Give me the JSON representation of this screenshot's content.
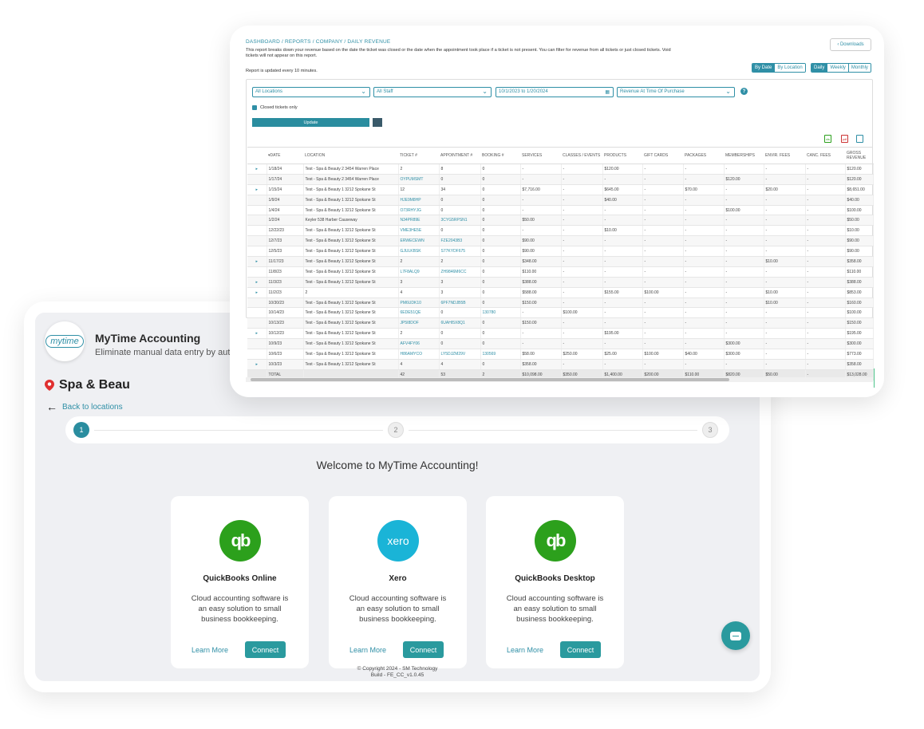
{
  "app": {
    "logo_text": "mytime",
    "title": "MyTime Accounting",
    "subtitle": "Eliminate manual data entry by automating yo",
    "location_name": "Spa & Beau",
    "back_label": "Back to locations",
    "steps": [
      "1",
      "2",
      "3"
    ],
    "welcome": "Welcome to MyTime Accounting!",
    "providers": [
      {
        "name": "QuickBooks Online",
        "logo": "qb",
        "description": "Cloud accounting software is an easy solution to small business bookkeeping.",
        "learn_more": "Learn More",
        "connect": "Connect"
      },
      {
        "name": "Xero",
        "logo": "xero",
        "description": "Cloud accounting software is an easy solution to small business bookkeeping.",
        "learn_more": "Learn More",
        "connect": "Connect"
      },
      {
        "name": "QuickBooks Desktop",
        "logo": "qb",
        "description": "Cloud accounting software is an easy solution to small business bookkeeping.",
        "learn_more": "Learn More",
        "connect": "Connect"
      }
    ],
    "copyright_line1": "© Copyright 2024 - SM Technology",
    "copyright_line2": "Build - FE_CC_v1.0.45",
    "accent_color": "#2a9a9e"
  },
  "report": {
    "breadcrumb": "DASHBOARD / REPORTS / COMPANY / DAILY REVENUE",
    "description": "This report breaks down your revenue based on the date the ticket was closed or the date when the appointment took place if a ticket is not present. You can filter for revenue from all tickets or just closed tickets. Void tickets will not appear on this report.",
    "updated_note": "Report is updated every 10 minutes.",
    "downloads_label": "‹ Downloads",
    "by_date": "By Date",
    "by_location": "By Location",
    "daily": "Daily",
    "weekly": "Weekly",
    "monthly": "Monthly",
    "location_filter": "All Locations",
    "staff_filter": "All Staff",
    "date_range": "10/1/2023 to 1/20/2024",
    "revenue_filter": "Revenue At Time Of Purchase",
    "closed_only_label": "Closed tickets only",
    "update_label": "Update",
    "columns": [
      "",
      "▾DATE",
      "LOCATION",
      "TICKET #",
      "APPOINTMENT #",
      "BOOKING #",
      "SERVICES",
      "CLASSES / EVENTS",
      "PRODUCTS",
      "GIFT CARDS",
      "PACKAGES",
      "MEMBERSHIPS",
      "ENVIR. FEES",
      "CANC. FEES",
      "GROSS REVENUE"
    ],
    "rows": [
      [
        "▸",
        "1/18/24",
        "Test - Spa & Beauty 2 3454 Warren Place",
        "2",
        "8",
        "0",
        "-",
        "-",
        "$120.00",
        "-",
        "-",
        "-",
        "-",
        "-",
        "$120.00"
      ],
      [
        "",
        "1/17/24",
        "Test - Spa & Beauty 2 3454 Warren Place",
        "OYPUMSMT",
        "0",
        "0",
        "-",
        "-",
        "-",
        "-",
        "-",
        "$120.00",
        "-",
        "-",
        "$120.00"
      ],
      [
        "▸",
        "1/15/24",
        "Test - Spa & Beauty 1 3212 Spokane St",
        "12",
        "34",
        "0",
        "$7,716.00",
        "-",
        "$645.00",
        "-",
        "$70.00",
        "-",
        "$20.00",
        "-",
        "$8,651.00"
      ],
      [
        "",
        "1/9/24",
        "Test - Spa & Beauty 1 3212 Spokane St",
        "HJE9M8HP",
        "0",
        "0",
        "-",
        "-",
        "$40.00",
        "-",
        "-",
        "-",
        "-",
        "-",
        "$40.00"
      ],
      [
        "",
        "1/4/24",
        "Test - Spa & Beauty 1 3212 Spokane St",
        "O73RHYJG",
        "0",
        "0",
        "-",
        "-",
        "-",
        "-",
        "-",
        "$100.00",
        "-",
        "-",
        "$100.00"
      ],
      [
        "",
        "1/2/24",
        "Keyler 538 Harber Causeway",
        "N34PR89E",
        "3CYG5RPSN1",
        "0",
        "$50.00",
        "-",
        "-",
        "-",
        "-",
        "-",
        "-",
        "-",
        "$50.00"
      ],
      [
        "",
        "12/22/23",
        "Test - Spa & Beauty 1 3212 Spokane St",
        "VME3HE5E",
        "0",
        "0",
        "-",
        "-",
        "$10.00",
        "-",
        "-",
        "-",
        "-",
        "-",
        "$10.00"
      ],
      [
        "",
        "12/7/23",
        "Test - Spa & Beauty 1 3212 Spokane St",
        "ERWECEWN",
        "FZE2043B3",
        "0",
        "$90.00",
        "-",
        "-",
        "-",
        "-",
        "-",
        "-",
        "-",
        "$90.00"
      ],
      [
        "",
        "12/5/23",
        "Test - Spa & Beauty 1 3212 Spokane St",
        "GJULKBSK",
        "S77KYDF675",
        "0",
        "$90.00",
        "-",
        "-",
        "-",
        "-",
        "-",
        "-",
        "-",
        "$90.00"
      ],
      [
        "▸",
        "11/17/23",
        "Test - Spa & Beauty 1 3212 Spokane St",
        "2",
        "2",
        "0",
        "$348.00",
        "-",
        "-",
        "-",
        "-",
        "-",
        "$10.00",
        "-",
        "$358.00"
      ],
      [
        "",
        "11/8/23",
        "Test - Spa & Beauty 1 3212 Spokane St",
        "L7F8ALQ9",
        "ZH9846M6CC",
        "0",
        "$110.00",
        "-",
        "-",
        "-",
        "-",
        "-",
        "-",
        "-",
        "$110.00"
      ],
      [
        "▸",
        "11/3/23",
        "Test - Spa & Beauty 1 3212 Spokane St",
        "3",
        "3",
        "0",
        "$388.00",
        "-",
        "-",
        "-",
        "-",
        "-",
        "-",
        "-",
        "$388.00"
      ],
      [
        "▸",
        "11/2/23",
        "2",
        "4",
        "3",
        "0",
        "$588.00",
        "-",
        "$155.00",
        "$100.00",
        "-",
        "-",
        "$10.00",
        "-",
        "$853.00"
      ],
      [
        "",
        "10/30/23",
        "Test - Spa & Beauty 1 3212 Spokane St",
        "PM6UDK10",
        "6PF7NDJB5B",
        "0",
        "$150.00",
        "-",
        "-",
        "-",
        "-",
        "-",
        "$10.00",
        "-",
        "$160.00"
      ],
      [
        "",
        "10/14/23",
        "Test - Spa & Beauty 1 3212 Spokane St",
        "6EDE51QE",
        "0",
        "130780",
        "-",
        "$100.00",
        "-",
        "-",
        "-",
        "-",
        "-",
        "-",
        "$100.00"
      ],
      [
        "",
        "10/13/23",
        "Test - Spa & Beauty 1 3212 Spokane St",
        "JP5I8DOF",
        "6UAHI5X8Q1",
        "0",
        "$150.00",
        "-",
        "-",
        "-",
        "-",
        "-",
        "-",
        "-",
        "$150.00"
      ],
      [
        "▸",
        "10/12/23",
        "Test - Spa & Beauty 1 3212 Spokane St",
        "2",
        "0",
        "0",
        "-",
        "-",
        "$195.00",
        "-",
        "-",
        "-",
        "-",
        "-",
        "$195.00"
      ],
      [
        "",
        "10/9/23",
        "Test - Spa & Beauty 1 3212 Spokane St",
        "AFV4FY06",
        "0",
        "0",
        "-",
        "-",
        "-",
        "-",
        "-",
        "$300.00",
        "-",
        "-",
        "$300.00"
      ],
      [
        "",
        "10/6/23",
        "Test - Spa & Beauty 1 3212 Spokane St",
        "H86AMYCO",
        "LY5DJZM29V",
        "130569",
        "$58.00",
        "$250.00",
        "$25.00",
        "$100.00",
        "$40.00",
        "$300.00",
        "-",
        "-",
        "$773.00"
      ],
      [
        "▸",
        "10/3/23",
        "Test - Spa & Beauty 1 3212 Spokane St",
        "4",
        "4",
        "0",
        "$358.00",
        "-",
        "-",
        "-",
        "-",
        "-",
        "-",
        "-",
        "$358.00"
      ]
    ],
    "total_row": [
      "",
      "TOTAL",
      "",
      "42",
      "53",
      "2",
      "$10,098.00",
      "$350.00",
      "$1,400.00",
      "$200.00",
      "$110.00",
      "$820.00",
      "$50.00",
      "-",
      "$13,028.00"
    ]
  }
}
